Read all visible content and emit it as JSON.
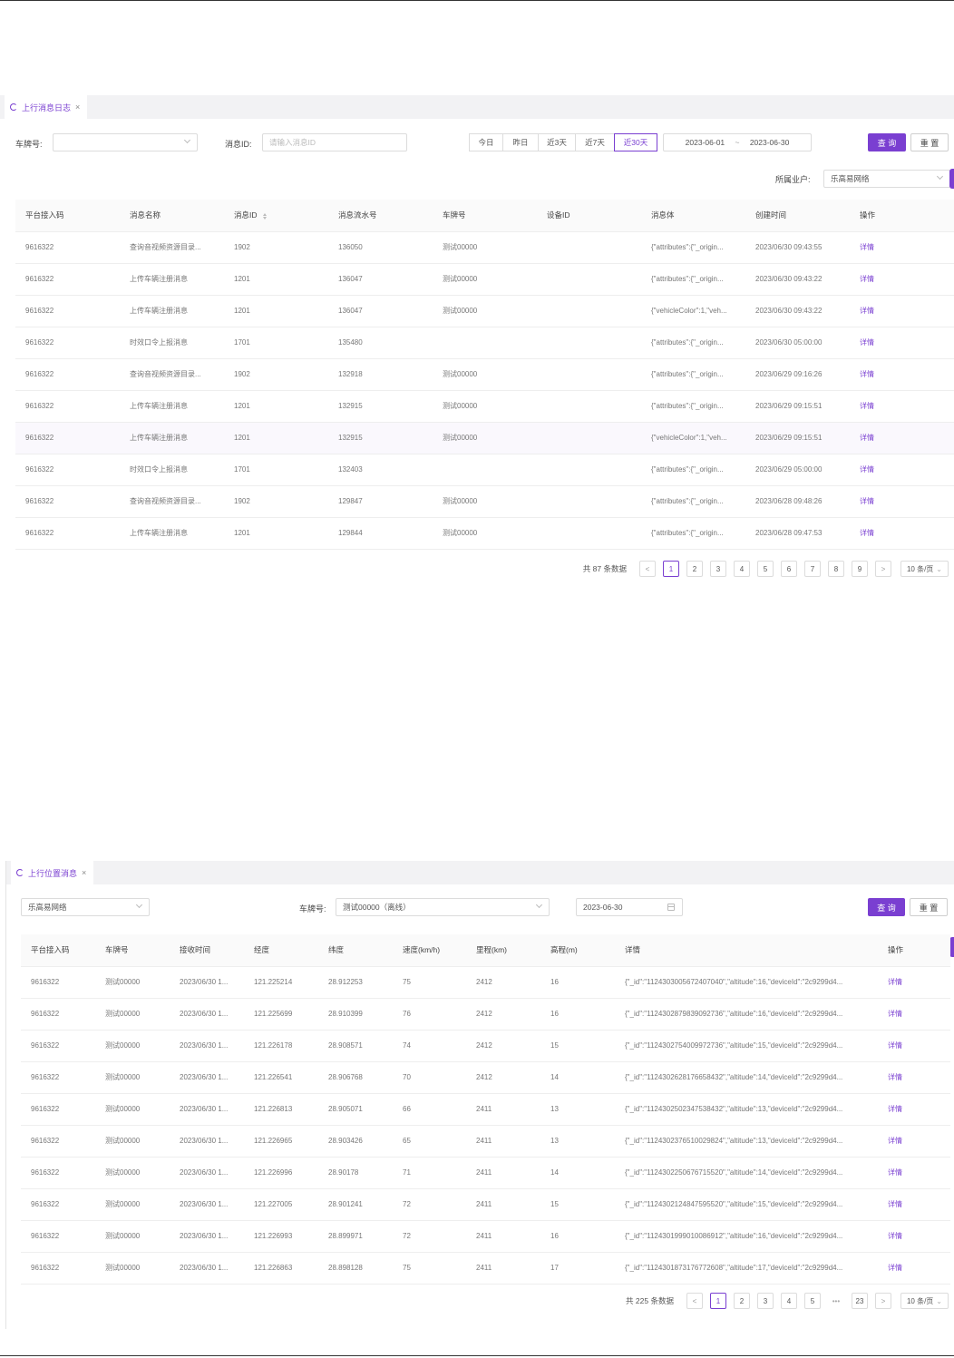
{
  "top_panel": {
    "tab_label": "上行消息日志",
    "filters": {
      "plate_label": "车牌号:",
      "plate_value": "",
      "msgid_label": "消息ID:",
      "msgid_placeholder": "请输入消息ID",
      "quick_ranges": [
        "今日",
        "昨日",
        "近3天",
        "近7天",
        "近30天"
      ],
      "active_range": "近30天",
      "date_start": "2023-06-01",
      "date_sep": "~",
      "date_end": "2023-06-30",
      "query_label": "查 询",
      "reset_label": "重 置",
      "tenant_label": "所属业户:",
      "tenant_value": "乐高易网络"
    },
    "columns": [
      "平台接入码",
      "消息名称",
      "消息ID",
      "消息流水号",
      "车牌号",
      "设备ID",
      "消息体",
      "创建时间",
      "操作"
    ],
    "rows": [
      [
        "9616322",
        "查询音视频资源目录...",
        "1902",
        "136050",
        "测试00000",
        "",
        "{\"attributes\":{\"_origin...",
        "2023/06/30 09:43:55",
        "详情"
      ],
      [
        "9616322",
        "上传车辆注册消息",
        "1201",
        "136047",
        "测试00000",
        "",
        "{\"attributes\":{\"_origin...",
        "2023/06/30 09:43:22",
        "详情"
      ],
      [
        "9616322",
        "上传车辆注册消息",
        "1201",
        "136047",
        "测试00000",
        "",
        "{\"vehicleColor\":1,\"veh...",
        "2023/06/30 09:43:22",
        "详情"
      ],
      [
        "9616322",
        "时效口令上报消息",
        "1701",
        "135480",
        "",
        "",
        "{\"attributes\":{\"_origin...",
        "2023/06/30 05:00:00",
        "详情"
      ],
      [
        "9616322",
        "查询音视频资源目录...",
        "1902",
        "132918",
        "测试00000",
        "",
        "{\"attributes\":{\"_origin...",
        "2023/06/29 09:16:26",
        "详情"
      ],
      [
        "9616322",
        "上传车辆注册消息",
        "1201",
        "132915",
        "测试00000",
        "",
        "{\"attributes\":{\"_origin...",
        "2023/06/29 09:15:51",
        "详情"
      ],
      [
        "9616322",
        "上传车辆注册消息",
        "1201",
        "132915",
        "测试00000",
        "",
        "{\"vehicleColor\":1,\"veh...",
        "2023/06/29 09:15:51",
        "详情"
      ],
      [
        "9616322",
        "时效口令上报消息",
        "1701",
        "132403",
        "",
        "",
        "{\"attributes\":{\"_origin...",
        "2023/06/29 05:00:00",
        "详情"
      ],
      [
        "9616322",
        "查询音视频资源目录...",
        "1902",
        "129847",
        "测试00000",
        "",
        "{\"attributes\":{\"_origin...",
        "2023/06/28 09:48:26",
        "详情"
      ],
      [
        "9616322",
        "上传车辆注册消息",
        "1201",
        "129844",
        "测试00000",
        "",
        "{\"attributes\":{\"_origin...",
        "2023/06/28 09:47:53",
        "详情"
      ]
    ],
    "pagination": {
      "total_text": "共 87 条数据",
      "pages": [
        "1",
        "2",
        "3",
        "4",
        "5",
        "6",
        "7",
        "8",
        "9"
      ],
      "current": "1",
      "prev": "<",
      "next": ">",
      "page_size": "10 条/页"
    }
  },
  "bottom_panel": {
    "tab_label": "上行位置消息",
    "filters": {
      "tenant_value": "乐高易网络",
      "plate_label": "车牌号:",
      "plate_value": "测试00000（离线）",
      "date_value": "2023-06-30",
      "query_label": "查 询",
      "reset_label": "重 置"
    },
    "columns": [
      "平台接入码",
      "车牌号",
      "接收时间",
      "经度",
      "纬度",
      "速度(km/h)",
      "里程(km)",
      "高程(m)",
      "详情",
      "操作"
    ],
    "rows": [
      [
        "9616322",
        "测试00000",
        "2023/06/30 1...",
        "121.225214",
        "28.912253",
        "75",
        "2412",
        "16",
        "{\"_id\":\"1124303005672407040\",\"altitude\":16,\"deviceId\":\"2c9299d4...",
        "详情"
      ],
      [
        "9616322",
        "测试00000",
        "2023/06/30 1...",
        "121.225699",
        "28.910399",
        "76",
        "2412",
        "16",
        "{\"_id\":\"1124302879839092736\",\"altitude\":16,\"deviceId\":\"2c9299d4...",
        "详情"
      ],
      [
        "9616322",
        "测试00000",
        "2023/06/30 1...",
        "121.226178",
        "28.908571",
        "74",
        "2412",
        "15",
        "{\"_id\":\"1124302754009972736\",\"altitude\":15,\"deviceId\":\"2c9299d4...",
        "详情"
      ],
      [
        "9616322",
        "测试00000",
        "2023/06/30 1...",
        "121.226541",
        "28.906768",
        "70",
        "2412",
        "14",
        "{\"_id\":\"1124302628176658432\",\"altitude\":14,\"deviceId\":\"2c9299d4...",
        "详情"
      ],
      [
        "9616322",
        "测试00000",
        "2023/06/30 1...",
        "121.226813",
        "28.905071",
        "66",
        "2411",
        "13",
        "{\"_id\":\"1124302502347538432\",\"altitude\":13,\"deviceId\":\"2c9299d4...",
        "详情"
      ],
      [
        "9616322",
        "测试00000",
        "2023/06/30 1...",
        "121.226965",
        "28.903426",
        "65",
        "2411",
        "13",
        "{\"_id\":\"1124302376510029824\",\"altitude\":13,\"deviceId\":\"2c9299d4...",
        "详情"
      ],
      [
        "9616322",
        "测试00000",
        "2023/06/30 1...",
        "121.226996",
        "28.90178",
        "71",
        "2411",
        "14",
        "{\"_id\":\"1124302250676715520\",\"altitude\":14,\"deviceId\":\"2c9299d4...",
        "详情"
      ],
      [
        "9616322",
        "测试00000",
        "2023/06/30 1...",
        "121.227005",
        "28.901241",
        "72",
        "2411",
        "15",
        "{\"_id\":\"1124302124847595520\",\"altitude\":15,\"deviceId\":\"2c9299d4...",
        "详情"
      ],
      [
        "9616322",
        "测试00000",
        "2023/06/30 1...",
        "121.226993",
        "28.899971",
        "72",
        "2411",
        "16",
        "{\"_id\":\"1124301999010086912\",\"altitude\":16,\"deviceId\":\"2c9299d4...",
        "详情"
      ],
      [
        "9616322",
        "测试00000",
        "2023/06/30 1...",
        "121.226863",
        "28.898128",
        "75",
        "2411",
        "17",
        "{\"_id\":\"1124301873176772608\",\"altitude\":17,\"deviceId\":\"2c9299d4...",
        "详情"
      ]
    ],
    "pagination": {
      "total_text": "共 225 条数据",
      "pages": [
        "1",
        "2",
        "3",
        "4",
        "5",
        "•••",
        "23"
      ],
      "current": "1",
      "prev": "<",
      "next": ">",
      "page_size": "10 条/页"
    }
  },
  "theme": {
    "accent": "#7a3fd1"
  }
}
